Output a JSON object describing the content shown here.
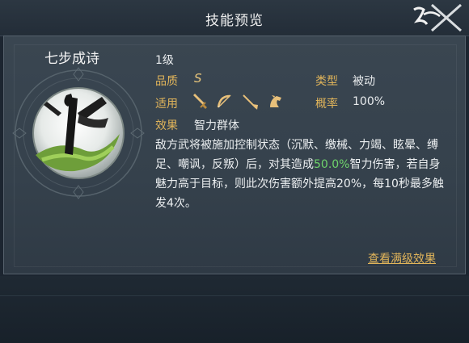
{
  "header": {
    "title": "技能预览"
  },
  "skill": {
    "name": "七步成诗",
    "level": "1级",
    "quality_label": "品质",
    "quality_value": "S",
    "type_label": "类型",
    "type_value": "被动",
    "apply_label": "适用",
    "apply_icons": [
      "sword-icon",
      "bow-icon",
      "spear-icon",
      "cavalry-horse-icon"
    ],
    "chance_label": "概率",
    "chance_value": "100%",
    "effect_label": "效果",
    "effect_value": "智力群体",
    "desc_part1": "敌方武将被施加控制状态（沉默、缴械、力竭、眩晕、缚足、嘲讽，反叛）后，对其造成",
    "desc_highlight": "50.0%",
    "desc_part2": "智力伤害，若自身魅力高于目标，则此次伤害额外提高20%，每10秒最多触发4次。"
  },
  "actions": {
    "view_max": "查看满级效果"
  },
  "colors": {
    "accent": "#e0b45a",
    "highlight": "#6fd36b",
    "panel": "#3a4651"
  }
}
